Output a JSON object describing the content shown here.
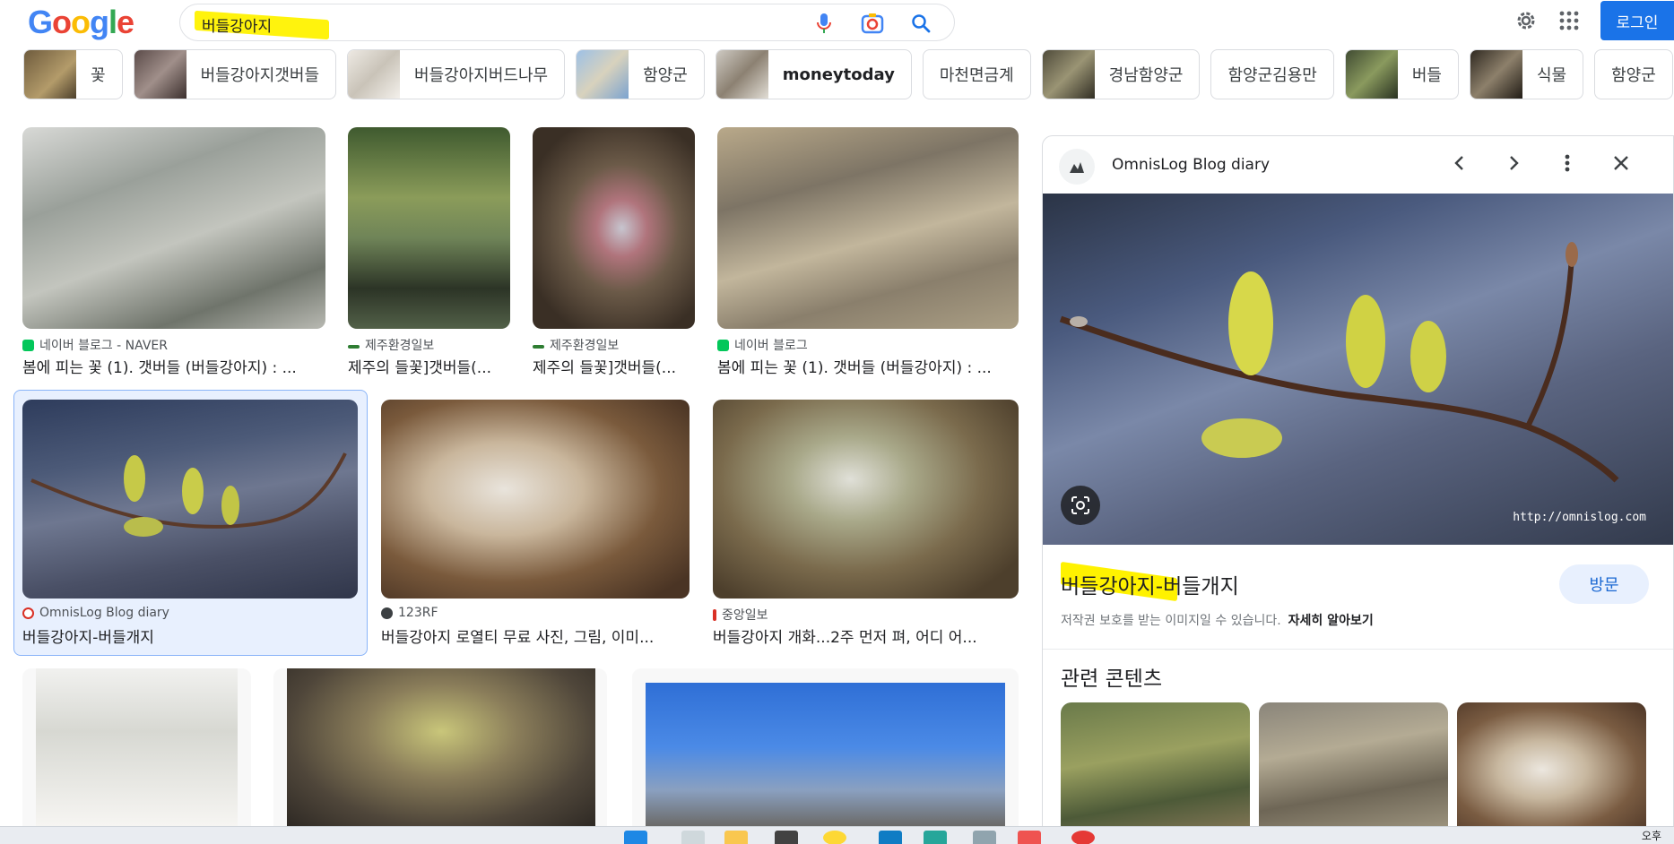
{
  "header": {
    "logo": [
      "G",
      "o",
      "o",
      "g",
      "l",
      "e"
    ],
    "logo_colors": [
      "#4285F4",
      "#EA4335",
      "#FBBC05",
      "#4285F4",
      "#34A853",
      "#EA4335"
    ],
    "query": "버들강아지",
    "login_label": "로그인"
  },
  "chips": [
    {
      "label": "꽃",
      "thumb": "#8a6a3a"
    },
    {
      "label": "버들강아지갯버들",
      "thumb": "#6b5a55"
    },
    {
      "label": "버들강아지버드나무",
      "thumb": "#d9d4cc"
    },
    {
      "label": "함양군",
      "thumb": "#8fb3d9"
    },
    {
      "label": "moneytoday",
      "thumb": "#a89d8e"
    },
    {
      "label": "마천면금계",
      "thumb": ""
    },
    {
      "label": "경남함양군",
      "thumb": "#6f6a52"
    },
    {
      "label": "함양군김용만",
      "thumb": ""
    },
    {
      "label": "버들",
      "thumb": "#5d6b47"
    },
    {
      "label": "식물",
      "thumb": "#4b4337"
    },
    {
      "label": "함양군",
      "thumb": ""
    }
  ],
  "results": [
    {
      "source": "네이버 블로그 - NAVER",
      "title": "봄에 피는 꽃 (1). 갯버들 (버들강아지) : ...",
      "fav": "#03c75a"
    },
    {
      "source": "제주환경일보",
      "title": "제주의 들꽃]갯버들(...",
      "fav": "#2e7d32"
    },
    {
      "source": "제주환경일보",
      "title": "제주의 들꽃]갯버들(...",
      "fav": "#2e7d32"
    },
    {
      "source": "네이버 블로그",
      "title": "봄에 피는 꽃 (1). 갯버들 (버들강아지) : ...",
      "fav": "#03c75a"
    },
    {
      "source": "OmnisLog Blog diary",
      "title": "버들강아지-버들개지",
      "fav": "#d93025"
    },
    {
      "source": "123RF",
      "title": "버들강아지 로열티 무료 사진, 그림, 이미...",
      "fav": "#5f6368"
    },
    {
      "source": "중앙일보",
      "title": "버들강아지 개화...2주 먼저 펴, 어디 어...",
      "fav": "#d93025"
    }
  ],
  "panel": {
    "site": "OmnisLog Blog diary",
    "watermark": "http://omnislog.com",
    "title": "버들강아지-버들개지",
    "visit_label": "방문",
    "copyright_note": "저작권 보호를 받는 이미지일 수 있습니다.",
    "learn_more": "자세히 알아보기",
    "related_title": "관련 콘텐츠"
  },
  "taskbar": {
    "time": "오후"
  },
  "colors": {
    "accent": "#1a73e8",
    "highlight": "#fff200",
    "selected_bg": "#e8f0fe"
  }
}
